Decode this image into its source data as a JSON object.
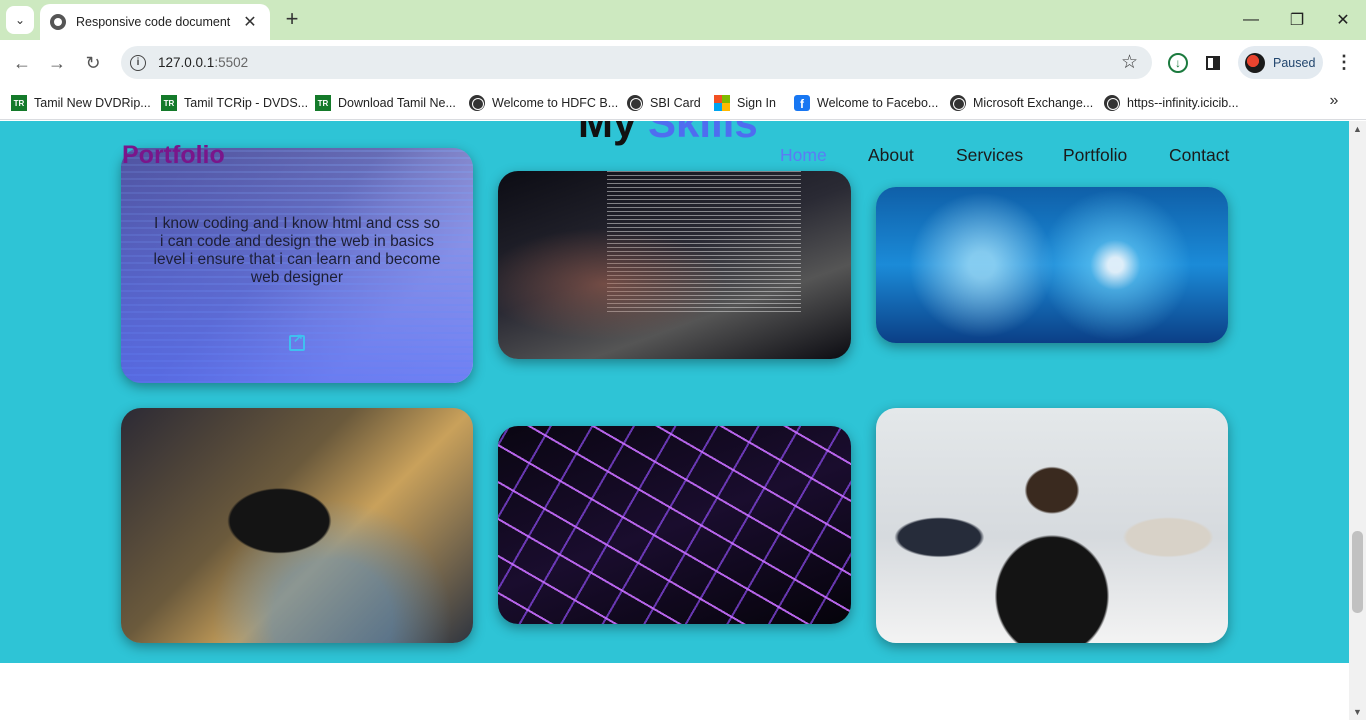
{
  "browser": {
    "tab_title": "Responsive code document",
    "url_host": "127.0.0.1",
    "url_port": ":5502",
    "profile_status": "Paused",
    "bookmarks": [
      {
        "label": "Tamil New DVDRip...",
        "icon": "tr-icon"
      },
      {
        "label": "Tamil TCRip - DVDS...",
        "icon": "tr-icon"
      },
      {
        "label": "Download Tamil Ne...",
        "icon": "tr-icon"
      },
      {
        "label": "Welcome to HDFC B...",
        "icon": "globe-icon"
      },
      {
        "label": "SBI Card",
        "icon": "globe-icon"
      },
      {
        "label": "Sign In",
        "icon": "microsoft-icon"
      },
      {
        "label": "Welcome to Facebo...",
        "icon": "facebook-icon"
      },
      {
        "label": "Microsoft Exchange...",
        "icon": "globe-icon"
      },
      {
        "label": "https--infinity.icicib...",
        "icon": "globe-icon"
      }
    ]
  },
  "page": {
    "heading_part1": "My",
    "heading_part2": "Skills",
    "logo": "Portfolio",
    "nav": [
      "Home",
      "About",
      "Services",
      "Portfolio",
      "Contact"
    ],
    "active_nav": "Home",
    "card_description": "I know coding and I know html and css so i can code and design the web in basics level i ensure that i can learn and become web designer",
    "cards": [
      {
        "image": "laptop-coding"
      },
      {
        "image": "hacker-laptop"
      },
      {
        "image": "digital-tech"
      },
      {
        "image": "headphones-laptop"
      },
      {
        "image": "purple-keyboard"
      },
      {
        "image": "business-meeting"
      }
    ],
    "colors": {
      "section_bg": "#2ec4d6",
      "logo": "#7a168b",
      "accent": "#4f6df0"
    }
  }
}
